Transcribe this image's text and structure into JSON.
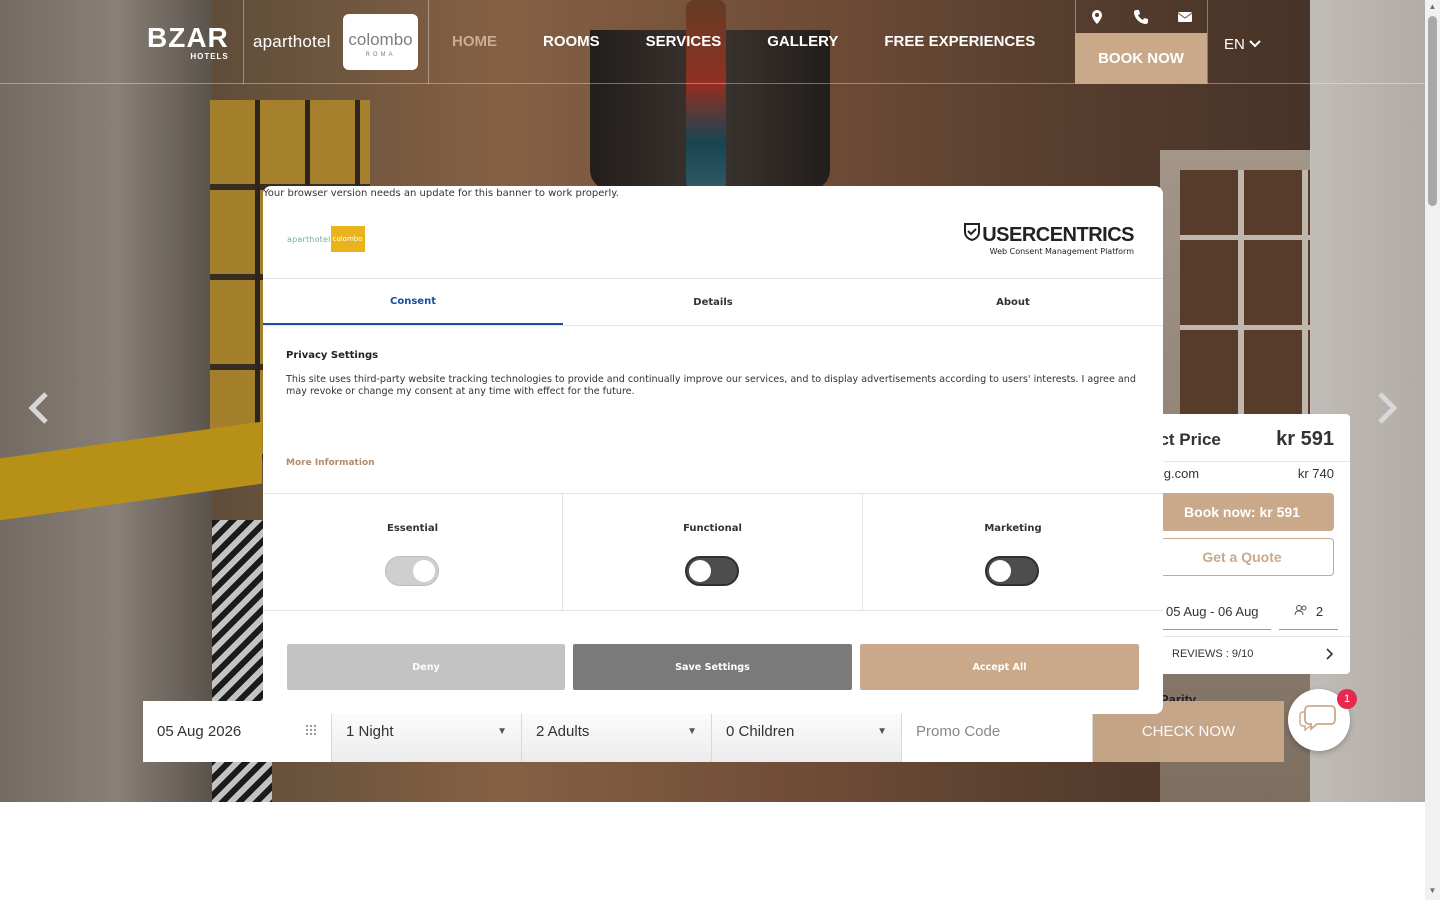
{
  "header": {
    "brand_name": "BZAR",
    "brand_sub": "HOTELS",
    "hotel_logo_left": "aparthotel",
    "hotel_logo_right": "colombo",
    "hotel_logo_city": "ROMA",
    "nav": [
      "HOME",
      "ROOMS",
      "SERVICES",
      "GALLERY",
      "FREE EXPERIENCES"
    ],
    "book_now": "BOOK NOW",
    "language": "EN",
    "icons": [
      "map-pin-icon",
      "phone-icon",
      "mail-icon"
    ]
  },
  "price_widget": {
    "title": "ect Price",
    "price": "kr 591",
    "ota_name": "ting.com",
    "ota_price": "kr 740",
    "book_label": "Book now: kr 591",
    "quote_label": "Get a Quote",
    "dates": "05 Aug - 06 Aug",
    "guests": "2",
    "reviews": "REVIEWS : 9/10",
    "parity": "Parity"
  },
  "booking_bar": {
    "date": "05 Aug 2026",
    "nights": "1 Night",
    "adults": "2 Adults",
    "children": "0 Children",
    "promo_placeholder": "Promo Code",
    "check_label": "CHECK NOW"
  },
  "chat": {
    "badge": "1"
  },
  "consent": {
    "warning": "Your browser version needs an update for this banner to work properly.",
    "logo_left": "aparthotel",
    "logo_right": "colombo",
    "provider_name": "USERCENTRICS",
    "provider_sub": "Web Consent Management Platform",
    "tabs": [
      "Consent",
      "Details",
      "About"
    ],
    "title": "Privacy Settings",
    "text": "This site uses third-party website tracking technologies to provide and continually improve our services, and to display advertisements according to users' interests. I agree and may revoke or change my consent at any time with effect for the future.",
    "more_info": "More Information",
    "toggles": [
      {
        "label": "Essential",
        "state": "on-disabled"
      },
      {
        "label": "Functional",
        "state": "off"
      },
      {
        "label": "Marketing",
        "state": "off"
      }
    ],
    "buttons": {
      "deny": "Deny",
      "save": "Save Settings",
      "accept": "Accept All"
    }
  },
  "colors": {
    "accent": "#c9a98a",
    "active_nav": "#c9ac92",
    "tab_active": "#1a4ea0",
    "badge": "#e5294f"
  }
}
